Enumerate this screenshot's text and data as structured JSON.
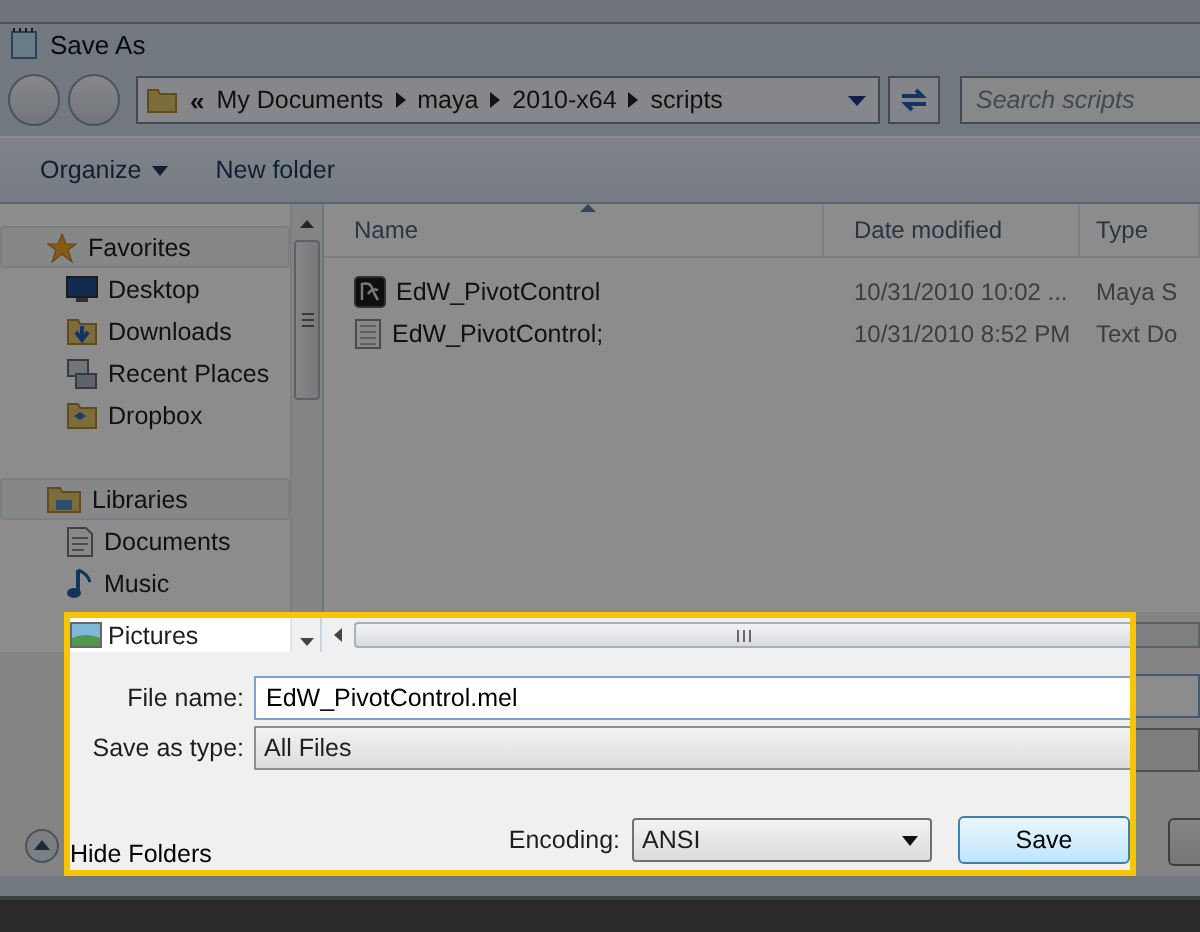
{
  "window": {
    "title": "Save As"
  },
  "address": {
    "overflow": "«",
    "crumbs": [
      "My Documents",
      "maya",
      "2010-x64",
      "scripts"
    ]
  },
  "search": {
    "placeholder": "Search scripts"
  },
  "toolbar": {
    "organize": "Organize",
    "new_folder": "New folder"
  },
  "navigation": [
    {
      "label": "Favorites",
      "kind": "group"
    },
    {
      "label": "Desktop",
      "kind": "item"
    },
    {
      "label": "Downloads",
      "kind": "item"
    },
    {
      "label": "Recent Places",
      "kind": "item"
    },
    {
      "label": "Dropbox",
      "kind": "item"
    },
    {
      "label": "Libraries",
      "kind": "group"
    },
    {
      "label": "Documents",
      "kind": "item"
    },
    {
      "label": "Music",
      "kind": "item"
    },
    {
      "label": "Pictures",
      "kind": "item"
    }
  ],
  "table": {
    "columns": [
      "Name",
      "Date modified",
      "Type"
    ],
    "rows": [
      {
        "kind": "maya",
        "cells": [
          "EdW_PivotControl",
          "10/31/2010 10:02 ...",
          "Maya S"
        ]
      },
      {
        "kind": "text",
        "cells": [
          "EdW_PivotControl;",
          "10/31/2010 8:52 PM",
          "Text Do"
        ]
      }
    ]
  },
  "form": {
    "file_name_label": "File name:",
    "file_name": "EdW_PivotControl.mel",
    "type_label": "Save as type:",
    "type": "All Files",
    "encoding_label": "Encoding:",
    "encoding": "ANSI",
    "save": "Save",
    "hide_folders": "Hide Folders"
  }
}
